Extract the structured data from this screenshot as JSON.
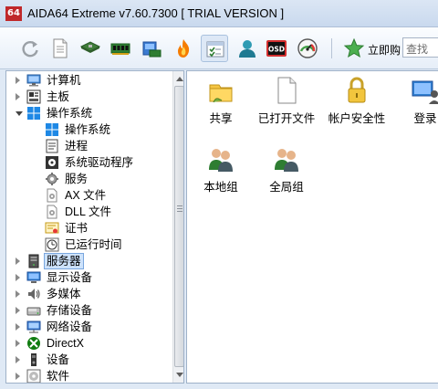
{
  "window": {
    "logo": "64",
    "title": "AIDA64 Extreme v7.60.7300  [ TRIAL VERSION ]"
  },
  "toolbar": {
    "buttons": [
      {
        "name": "refresh-icon"
      },
      {
        "name": "report-icon"
      },
      {
        "name": "motherboard-icon"
      },
      {
        "name": "memory-icon"
      },
      {
        "name": "network-card-icon"
      },
      {
        "name": "flame-icon"
      },
      {
        "name": "system-tools-icon"
      },
      {
        "name": "user-icon"
      },
      {
        "name": "osd-icon",
        "text": "OSD"
      },
      {
        "name": "gauge-icon"
      }
    ],
    "buy_label": "立即购",
    "search_placeholder": "查找"
  },
  "tree": {
    "items": [
      {
        "label": "计算机",
        "icon": "computer-icon",
        "level": 0,
        "arrow": "collapsed"
      },
      {
        "label": "主板",
        "icon": "motherboard-icon",
        "level": 0,
        "arrow": "collapsed"
      },
      {
        "label": "操作系统",
        "icon": "windows-icon",
        "level": 0,
        "arrow": "expanded"
      },
      {
        "label": "操作系统",
        "icon": "windows-icon",
        "level": 1
      },
      {
        "label": "进程",
        "icon": "process-icon",
        "level": 1
      },
      {
        "label": "系统驱动程序",
        "icon": "driver-icon",
        "level": 1
      },
      {
        "label": "服务",
        "icon": "service-gear-icon",
        "level": 1
      },
      {
        "label": "AX 文件",
        "icon": "ax-file-icon",
        "level": 1
      },
      {
        "label": "DLL 文件",
        "icon": "dll-file-icon",
        "level": 1
      },
      {
        "label": "证书",
        "icon": "certificate-icon",
        "level": 1
      },
      {
        "label": "已运行时间",
        "icon": "uptime-icon",
        "level": 1
      },
      {
        "label": "服务器",
        "icon": "server-icon",
        "level": 0,
        "arrow": "collapsed",
        "selected": true
      },
      {
        "label": "显示设备",
        "icon": "display-icon",
        "level": 0,
        "arrow": "collapsed"
      },
      {
        "label": "多媒体",
        "icon": "speaker-icon",
        "level": 0,
        "arrow": "collapsed"
      },
      {
        "label": "存储设备",
        "icon": "storage-icon",
        "level": 0,
        "arrow": "collapsed"
      },
      {
        "label": "网络设备",
        "icon": "network-icon",
        "level": 0,
        "arrow": "collapsed"
      },
      {
        "label": "DirectX",
        "icon": "xbox-icon",
        "level": 0,
        "arrow": "collapsed"
      },
      {
        "label": "设备",
        "icon": "device-icon",
        "level": 0,
        "arrow": "collapsed"
      },
      {
        "label": "软件",
        "icon": "software-icon",
        "level": 0,
        "arrow": "collapsed"
      }
    ]
  },
  "content": {
    "items": [
      {
        "label": "共享",
        "icon": "shared-folder-icon"
      },
      {
        "label": "已打开文件",
        "icon": "open-file-icon"
      },
      {
        "label": "帐户安全性",
        "icon": "padlock-icon"
      },
      {
        "label": "登录",
        "icon": "login-icon"
      },
      {
        "label": "本地组",
        "icon": "local-group-icon"
      },
      {
        "label": "全局组",
        "icon": "global-group-icon"
      }
    ]
  }
}
